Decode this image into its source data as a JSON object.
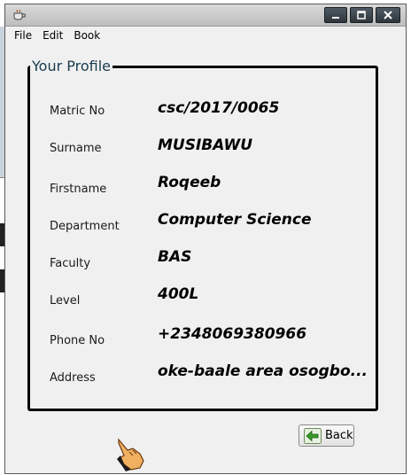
{
  "window": {
    "app_icon": "coffee-cup-icon"
  },
  "menu": {
    "items": [
      "File",
      "Edit",
      "Book"
    ]
  },
  "profile": {
    "title": "Your Profile",
    "fields": [
      {
        "label": "Matric No",
        "value": "csc/2017/0065"
      },
      {
        "label": "Surname",
        "value": "MUSIBAWU"
      },
      {
        "label": "Firstname",
        "value": "Roqeeb"
      },
      {
        "label": "Department",
        "value": "Computer Science"
      },
      {
        "label": "Faculty",
        "value": "BAS"
      },
      {
        "label": "Level",
        "value": "400L"
      },
      {
        "label": "Phone No",
        "value": "+2348069380966"
      },
      {
        "label": "Address",
        "value": "oke-baale area osogbo..."
      }
    ]
  },
  "actions": {
    "back_label": "Back"
  },
  "colors": {
    "title_color": "#1a3b4f",
    "back_arrow": "#3a9a2a"
  }
}
